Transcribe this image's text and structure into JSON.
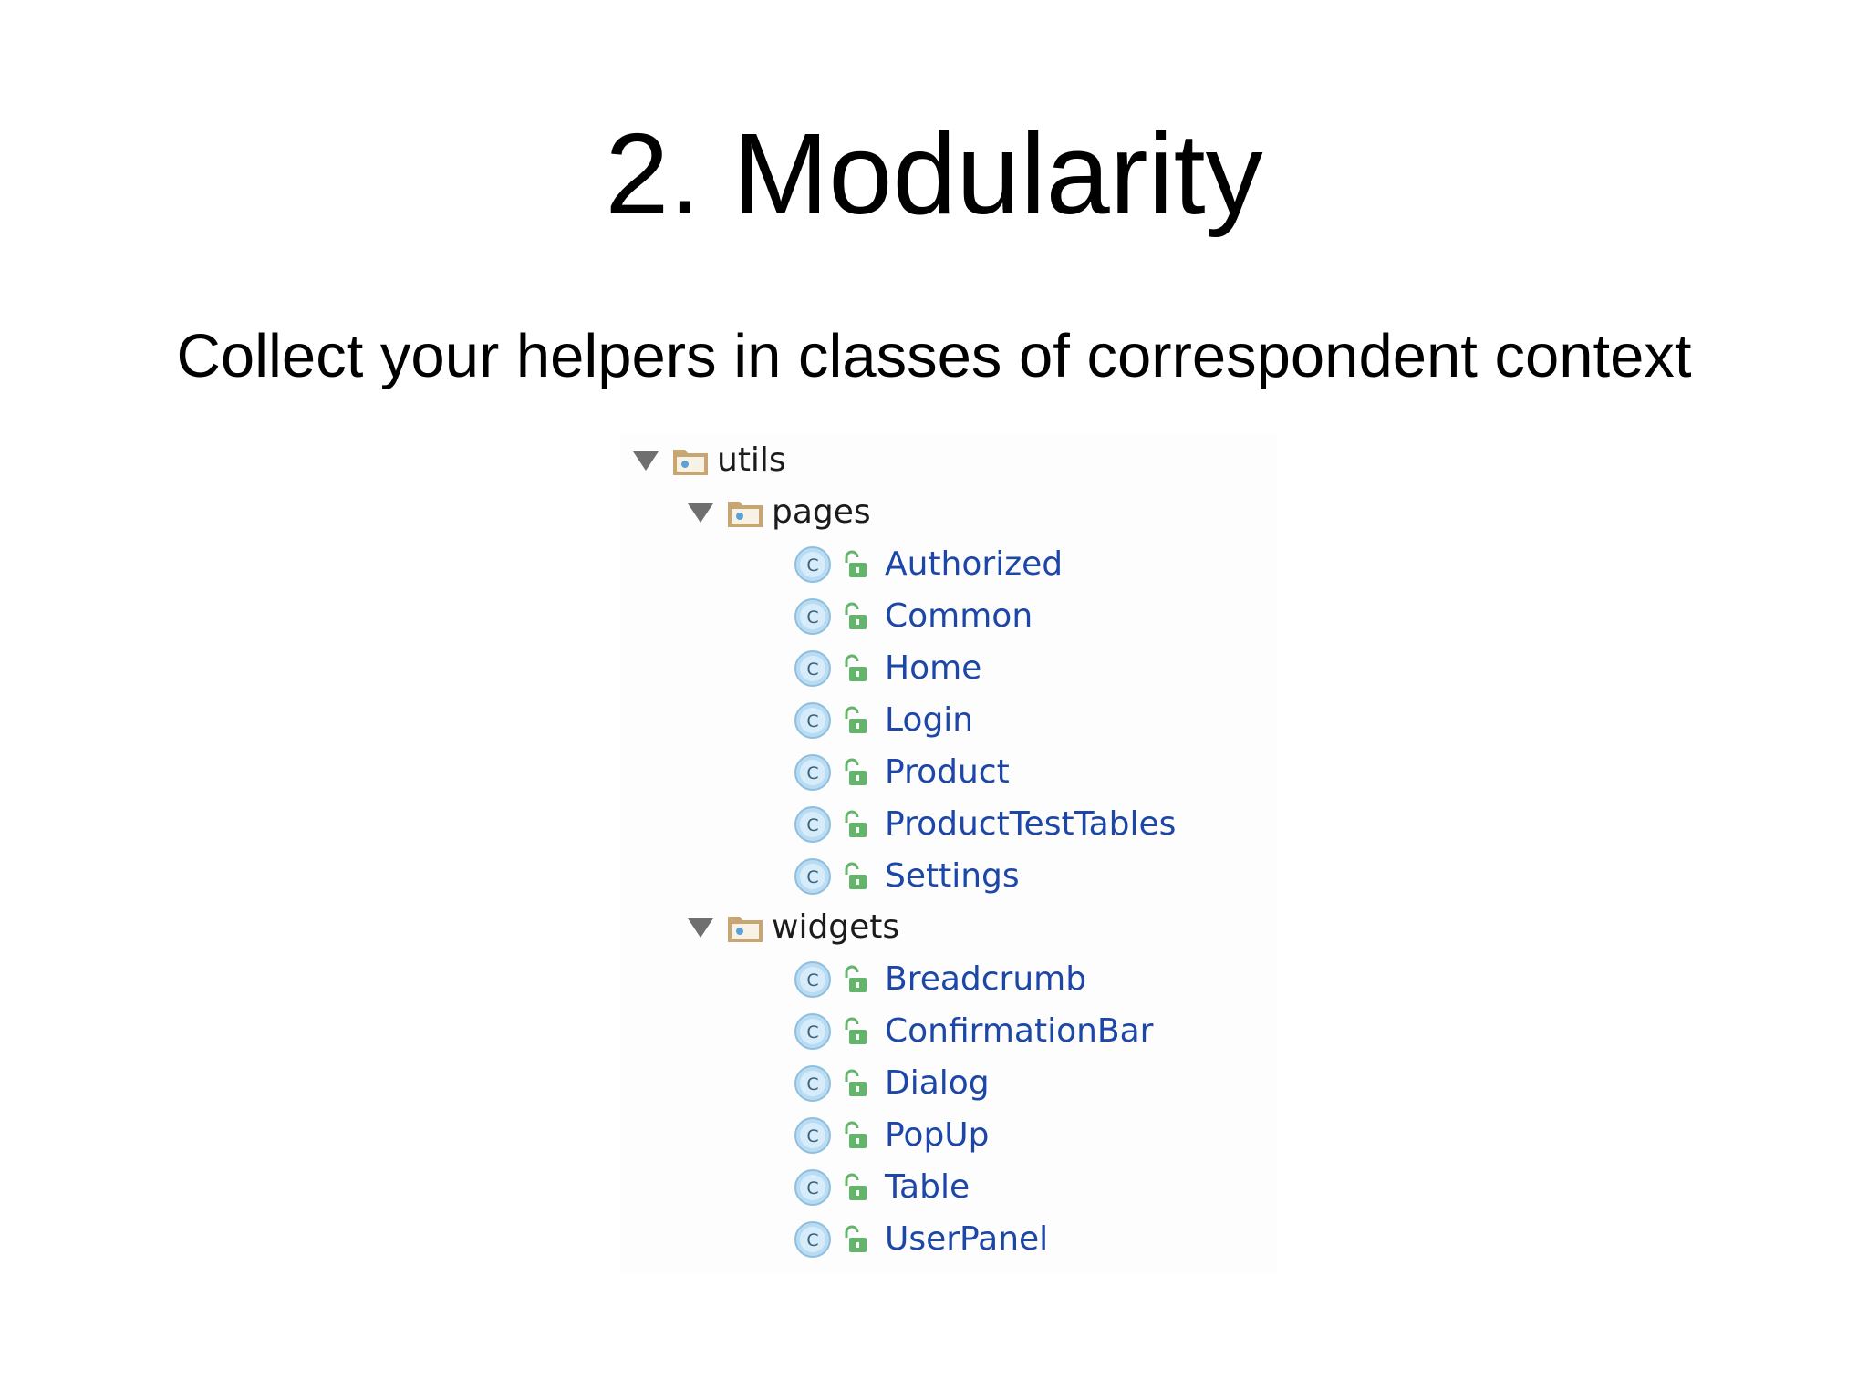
{
  "slide": {
    "title": "2. Modularity",
    "subtitle": "Collect your helpers in classes of correspondent context"
  },
  "tree": {
    "root": {
      "label": "utils",
      "expanded": true,
      "icon": "package-folder-icon",
      "children": [
        {
          "label": "pages",
          "expanded": true,
          "icon": "package-folder-icon",
          "classes": [
            "Authorized",
            "Common",
            "Home",
            "Login",
            "Product",
            "ProductTestTables",
            "Settings"
          ]
        },
        {
          "label": "widgets",
          "expanded": true,
          "icon": "package-folder-icon",
          "classes": [
            "Breadcrumb",
            "ConfirmationBar",
            "Dialog",
            "PopUp",
            "Table",
            "UserPanel"
          ]
        }
      ]
    }
  },
  "icons": {
    "expand_toggle": "triangle-down-icon",
    "folder": "package-folder-icon",
    "class": "class-c-icon",
    "access": "public-unlock-icon"
  },
  "colors": {
    "class_label": "#1c47a8",
    "folder_label": "#1b1b1b",
    "folder": "#c8a674",
    "class_badge": "#b9dcf2",
    "access_badge": "#64b46c",
    "toggle": "#6f6f6f"
  }
}
